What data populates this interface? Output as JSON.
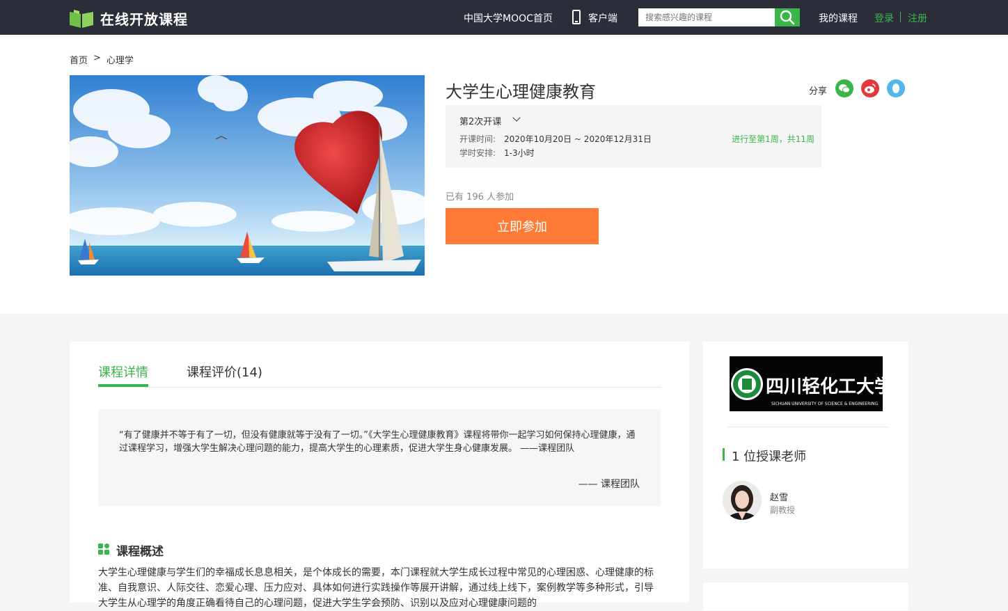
{
  "nav": {
    "site_name": "在线开放课程",
    "mooc_home": "中国大学MOOC首页",
    "client": "客户端",
    "search_placeholder": "搜索感兴趣的课程",
    "my_courses": "我的课程",
    "login": "登录",
    "register": "注册"
  },
  "breadcrumb": {
    "home": "首页",
    "sep": ">",
    "category": "心理学"
  },
  "course": {
    "title": "大学生心理健康教育",
    "share_label": "分享",
    "term_selector": "第2次开课",
    "open_time_label": "开课时间:",
    "open_time_value": "2020年10月20日 ~ 2020年12月31日",
    "hours_label": "学时安排:",
    "hours_value": "1-3小时",
    "progress": "进行至第1周，共11周",
    "enrolled": "已有 196 人参加",
    "join_button": "立即参加"
  },
  "tabs": [
    {
      "label": "课程详情"
    },
    {
      "label": "课程评价(14)"
    }
  ],
  "quote": {
    "text": "“有了健康并不等于有了一切，但没有健康就等于没有了一切。”《大学生心理健康教育》课程将带你一起学习如何保持心理健康，通过课程学习，增强大学生解决心理问题的能力，提高大学生的心理素质，促进大学生身心健康发展。 ——课程团队",
    "signature": "—— 课程团队"
  },
  "overview": {
    "title": "课程概述",
    "text": "大学生心理健康与学生们的幸福成长息息相关，是个体成长的需要，本门课程就大学生成长过程中常见的心理困惑、心理健康的标准、自我意识、人际交往、恋爱心理、压力应对、具体如何进行实践操作等展开讲解，通过线上线下，案例教学等多种形式，引导大学生从心理学的角度正确看待自己的心理问题，促进大学生学会预防、识别以及应对心理健康问题的"
  },
  "sidebar": {
    "school_logo_text": "四川轻化工大学",
    "school_logo_en": "SICHUAN UNIVERSITY OF SCIENCE & ENGINEERING",
    "teacher_count": "1 位授课老师",
    "teacher": {
      "name": "赵雪",
      "title": "副教授"
    }
  },
  "colors": {
    "accent": "#39b54a",
    "join": "#fe7a37",
    "nav_bg": "#2b2e38"
  }
}
